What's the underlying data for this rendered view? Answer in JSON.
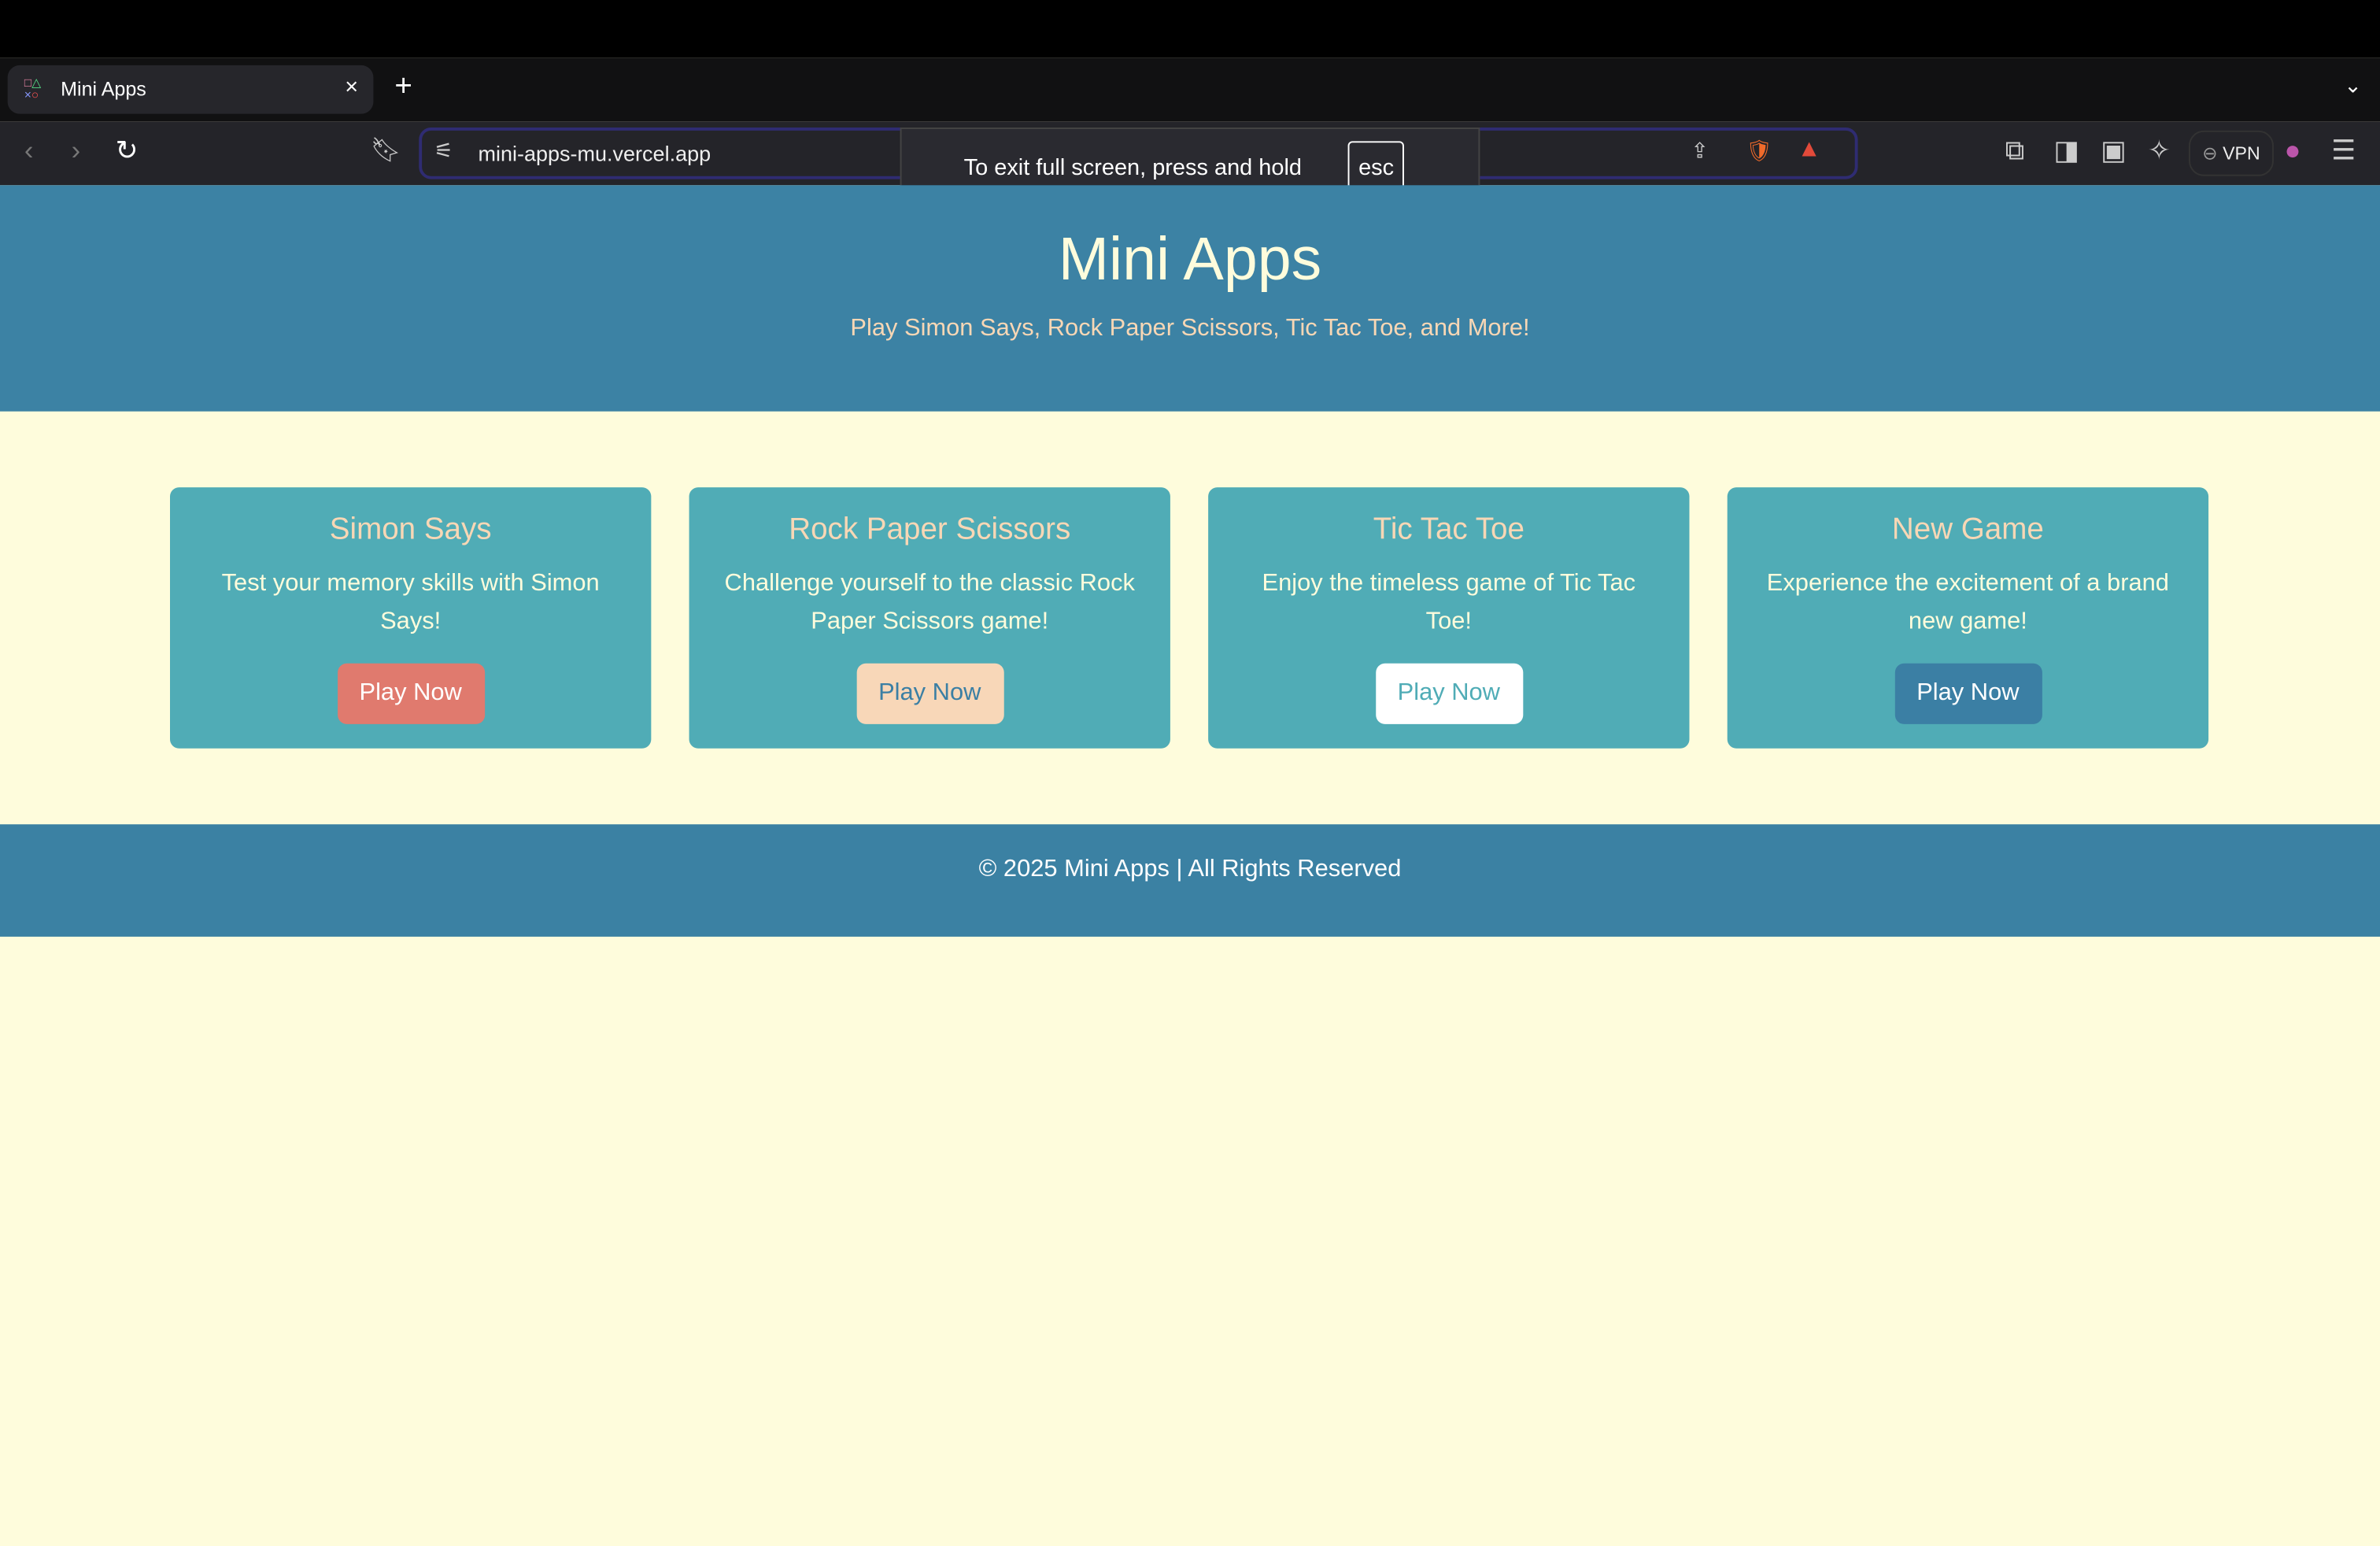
{
  "browser": {
    "tab_title": "Mini Apps",
    "url": "mini-apps-mu.vercel.app",
    "vpn_label": "VPN",
    "fullscreen_message": "To exit full screen, press and hold",
    "fullscreen_key": "esc"
  },
  "header": {
    "title": "Mini Apps",
    "subtitle": "Play Simon Says, Rock Paper Scissors, Tic Tac Toe, and More!"
  },
  "cards": [
    {
      "title": "Simon Says",
      "description": "Test your memory skills with Simon Says!",
      "button": "Play Now",
      "button_bg": "#e07a6e",
      "button_color": "#ffffff"
    },
    {
      "title": "Rock Paper Scissors",
      "description": "Challenge yourself to the classic Rock Paper Scissors game!",
      "button": "Play Now",
      "button_bg": "#f8d7b8",
      "button_color": "#3b7fa4"
    },
    {
      "title": "Tic Tac Toe",
      "description": "Enjoy the timeless game of Tic Tac Toe!",
      "button": "Play Now",
      "button_bg": "#ffffff",
      "button_color": "#50acb6"
    },
    {
      "title": "New Game",
      "description": "Experience the excitement of a brand new game!",
      "button": "Play Now",
      "button_bg": "#3b7fa4",
      "button_color": "#ffffff"
    }
  ],
  "footer": {
    "text": "© 2025 Mini Apps | All Rights Reserved"
  },
  "colors": {
    "header_bg": "#3c82a4",
    "page_bg": "#fefcdc",
    "card_bg": "#50acb6",
    "accent_text": "#f8d7b5"
  }
}
